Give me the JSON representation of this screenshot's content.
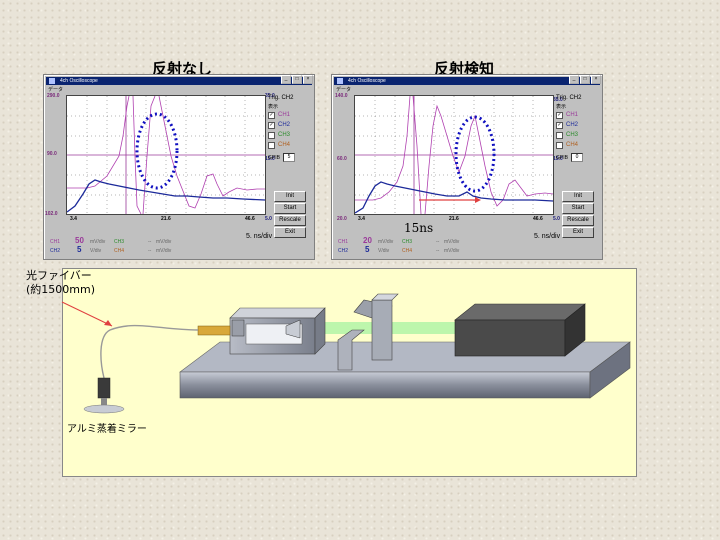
{
  "titles": {
    "left": "反射なし",
    "right": "反射検知"
  },
  "osc_left": {
    "window_title": "4ch Oscilloscope",
    "menu": "データ",
    "y_top_left": "290.0",
    "y_mid_left": "90.0",
    "y_bot_left": "102.0",
    "y_top_right": "35.0",
    "y_mid_right": "15.0",
    "y_bot_right": "5.0",
    "x_left": "3.4",
    "x_mid": "21.6",
    "x_right": "46.6",
    "trig": "Trig. CH2",
    "display_label": "表示",
    "channels": [
      {
        "name": "CH1",
        "checked": "✓",
        "color": "#9a3a9a"
      },
      {
        "name": "CH2",
        "checked": "✓",
        "color": "#1c2a9a"
      },
      {
        "name": "CH3",
        "checked": "",
        "color": "#2a8a2a"
      },
      {
        "name": "CH4",
        "checked": "",
        "color": "#b06020"
      }
    ],
    "gpib_label": "GPIB",
    "gpib_value": "5",
    "buttons": {
      "init": "Init",
      "start": "Start",
      "rescale": "Rescale",
      "exit": "Exit"
    },
    "ch1_label": "CH1",
    "ch1_value": "50",
    "ch1_unit": "mV/div",
    "ch2_label": "CH2",
    "ch2_value": "5",
    "ch2_unit": "V/div",
    "ch3_label": "CH3",
    "ch3_value": "--",
    "ch3_unit": "mV/div",
    "ch4_label": "CH4",
    "ch4_value": "--",
    "ch4_unit": "mV/div",
    "timediv": "5. ns/div"
  },
  "osc_right": {
    "window_title": "4ch Oscilloscope",
    "menu": "データ",
    "y_top_left": "140.0",
    "y_mid_left": "60.0",
    "y_bot_left": "20.0",
    "y_top_right": "35.0",
    "y_mid_right": "15.0",
    "y_bot_right": "5.0",
    "x_left": "3.4",
    "x_mid": "21.6",
    "x_right": "46.6",
    "trig": "Trig. CH2",
    "display_label": "表示",
    "channels": [
      {
        "name": "CH1",
        "checked": "✓",
        "color": "#9a3a9a"
      },
      {
        "name": "CH2",
        "checked": "✓",
        "color": "#1c2a9a"
      },
      {
        "name": "CH3",
        "checked": "",
        "color": "#2a8a2a"
      },
      {
        "name": "CH4",
        "checked": "",
        "color": "#b06020"
      }
    ],
    "gpib_label": "GPIB",
    "gpib_value": "0",
    "buttons": {
      "init": "Init",
      "start": "Start",
      "rescale": "Rescale",
      "exit": "Exit"
    },
    "ch1_label": "CH1",
    "ch1_value": "20",
    "ch1_unit": "mV/div",
    "ch2_label": "CH2",
    "ch2_value": "5",
    "ch2_unit": "V/div",
    "ch3_label": "CH3",
    "ch3_value": "--",
    "ch3_unit": "mV/div",
    "ch4_label": "CH4",
    "ch4_value": "--",
    "ch4_unit": "mV/div",
    "timediv": "5. ns/div"
  },
  "annotation_15ns": "15ns",
  "diagram": {
    "fiber_label_line1": "光ファイバー",
    "fiber_label_line2": "(約1500mm)",
    "mirror_label": "アルミ蒸着ミラー"
  },
  "colors": {
    "window_title_bg": "#0a2470",
    "panel_bg": "#ffffcc",
    "ch1": "#9a3a9a",
    "ch2": "#1c2a9a",
    "dotted_ellipse": "#1010c0",
    "beam": "#a8f0a0",
    "arrow": "#e04040"
  }
}
